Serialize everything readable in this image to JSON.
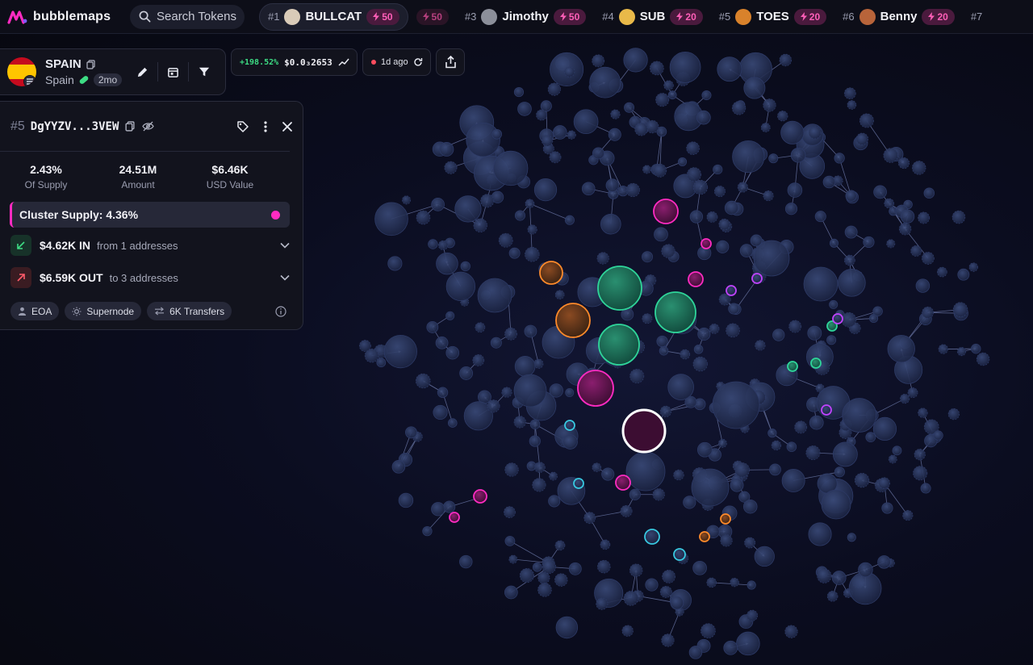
{
  "brand": {
    "name": "bubblemaps"
  },
  "search": {
    "label": "Search Tokens"
  },
  "trending": [
    {
      "rank": "#1",
      "name": "BULLCAT",
      "boost": "50",
      "avatar_color": "#d9cbb8",
      "active": true
    },
    {
      "rank": "",
      "name": "",
      "boost": "50",
      "avatar_color": "",
      "active": false
    },
    {
      "rank": "#3",
      "name": "Jimothy",
      "boost": "50",
      "avatar_color": "#8c8f9a",
      "active": false
    },
    {
      "rank": "#4",
      "name": "SUB",
      "boost": "20",
      "avatar_color": "#e9b949",
      "active": false
    },
    {
      "rank": "#5",
      "name": "TOES",
      "boost": "20",
      "avatar_color": "#d9822b",
      "active": false
    },
    {
      "rank": "#6",
      "name": "Benny",
      "boost": "20",
      "avatar_color": "#b8643a",
      "active": false
    },
    {
      "rank": "#7",
      "name": "",
      "boost": "",
      "avatar_color": "",
      "active": false
    }
  ],
  "token": {
    "symbol": "SPAIN",
    "name": "Spain",
    "age": "2mo"
  },
  "price": {
    "change": "+198.52%",
    "value": "$0.0₃2653"
  },
  "refresh": {
    "label": "1d ago"
  },
  "wallet": {
    "rank": "#5",
    "address": "DgYYZV...3VEW",
    "stats": [
      {
        "value": "2.43%",
        "label": "Of Supply"
      },
      {
        "value": "24.51M",
        "label": "Amount"
      },
      {
        "value": "$6.46K",
        "label": "USD Value"
      }
    ],
    "cluster_supply": "Cluster Supply: 4.36%",
    "inflow": {
      "amount": "$4.62K IN",
      "detail": "from 1 addresses"
    },
    "outflow": {
      "amount": "$6.59K OUT",
      "detail": "to 3 addresses"
    },
    "tags": [
      "EOA",
      "Supernode",
      "6K Transfers"
    ]
  },
  "colors": {
    "accent_pink": "#ff2bc2",
    "green": "#2fd59a",
    "orange": "#ff8a2a",
    "cyan": "#38c8e0",
    "purple": "#c043ff",
    "node": "#1f2a4a"
  }
}
